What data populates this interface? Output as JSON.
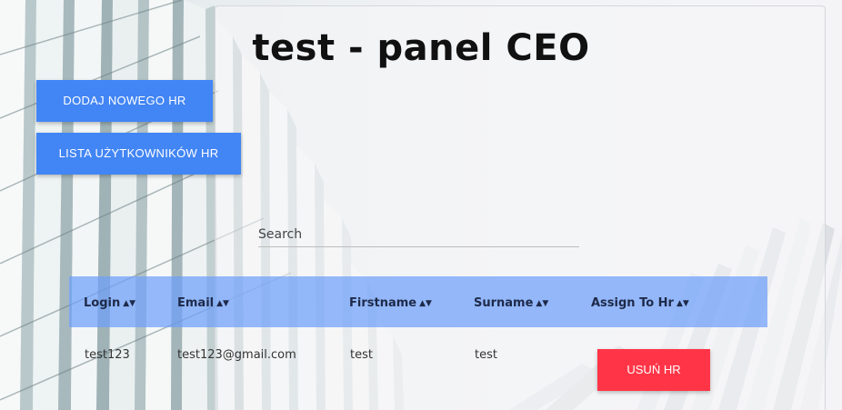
{
  "page": {
    "title": "test - panel CEO"
  },
  "buttons": {
    "add_hr": "DODAJ NOWEGO HR",
    "list_hr": "LISTA UŻYTKOWNIKÓW HR"
  },
  "search": {
    "placeholder": "Search",
    "value": ""
  },
  "table": {
    "columns": [
      "Login",
      "Email",
      "Firstname",
      "Surname",
      "Assign To Hr"
    ],
    "rows": [
      {
        "login": "test123",
        "email": "test123@gmail.com",
        "firstname": "test",
        "surname": "test",
        "action": "USUŃ HR"
      }
    ]
  },
  "colors": {
    "primary": "#4285f4",
    "danger": "#ff3547",
    "table_header": "#6da0fa"
  },
  "icons": {
    "sort": "sort-icon"
  }
}
